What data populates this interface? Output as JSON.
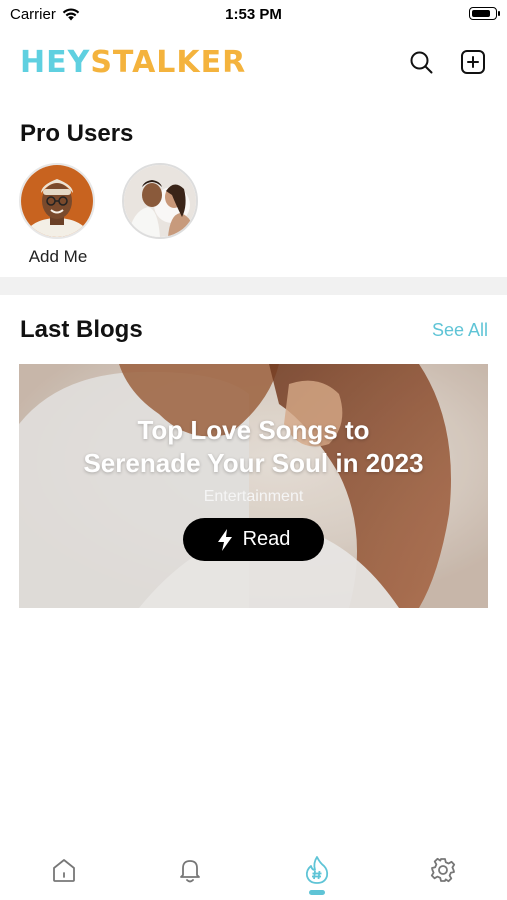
{
  "status_bar": {
    "carrier": "Carrier",
    "time": "1:53 PM",
    "battery_level": 0.9
  },
  "header": {
    "logo_part1": "HEY",
    "logo_part2": "STALKER",
    "icons": [
      "search-icon",
      "add-square-icon"
    ]
  },
  "pro_users": {
    "title": "Pro Users",
    "items": [
      {
        "label": "Add Me",
        "avatar": "avatar-man"
      },
      {
        "label": "",
        "avatar": "avatar-couple"
      }
    ]
  },
  "last_blogs": {
    "title": "Last Blogs",
    "see_all": "See All",
    "card": {
      "title_line1": "Top Love Songs to",
      "title_line2": "Serenade Your Soul in 2023",
      "category": "Entertainment",
      "read_label": "Read",
      "read_icon": "lightning-icon"
    }
  },
  "tab_bar": {
    "tabs": [
      "home-icon",
      "bell-icon",
      "hashtag-flame-icon",
      "gear-icon"
    ],
    "active_index": 2
  },
  "colors": {
    "accent": "#5fc4d6",
    "logo_cyan": "#5fd0e0",
    "logo_orange": "#f4b33d"
  }
}
